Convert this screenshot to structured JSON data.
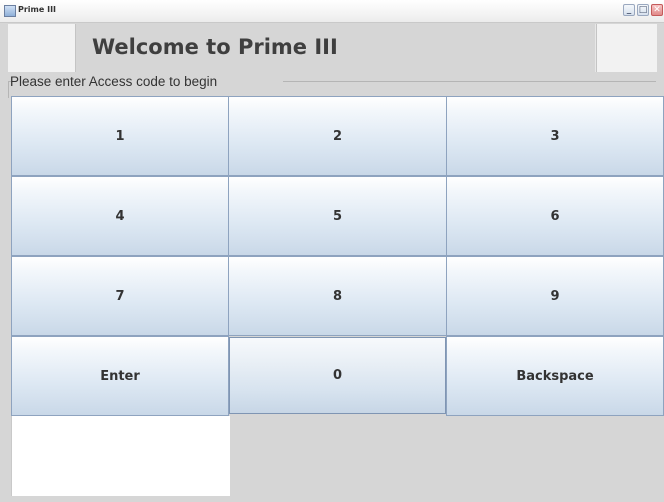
{
  "window": {
    "title": "Prime III",
    "controls": {
      "minimize": "_",
      "maximize": "□",
      "close": "✕"
    }
  },
  "header": {
    "title": "Welcome to Prime III"
  },
  "prompt": {
    "text": "Please enter Access code to begin"
  },
  "keypad": {
    "keys": [
      {
        "label": "1",
        "name": "key-1-button"
      },
      {
        "label": "2",
        "name": "key-2-button"
      },
      {
        "label": "3",
        "name": "key-3-button"
      },
      {
        "label": "4",
        "name": "key-4-button"
      },
      {
        "label": "5",
        "name": "key-5-button"
      },
      {
        "label": "6",
        "name": "key-6-button"
      },
      {
        "label": "7",
        "name": "key-7-button"
      },
      {
        "label": "8",
        "name": "key-8-button"
      },
      {
        "label": "9",
        "name": "key-9-button"
      },
      {
        "label": "Enter",
        "name": "enter-button"
      },
      {
        "label": "0",
        "name": "key-0-button"
      },
      {
        "label": "Backspace",
        "name": "backspace-button"
      }
    ]
  },
  "colors": {
    "background": "#d6d6d6",
    "key_border": "#8ea3bf",
    "key_gradient_top": "#ffffff",
    "key_gradient_bottom": "#c9d8e8",
    "text": "#333333"
  }
}
